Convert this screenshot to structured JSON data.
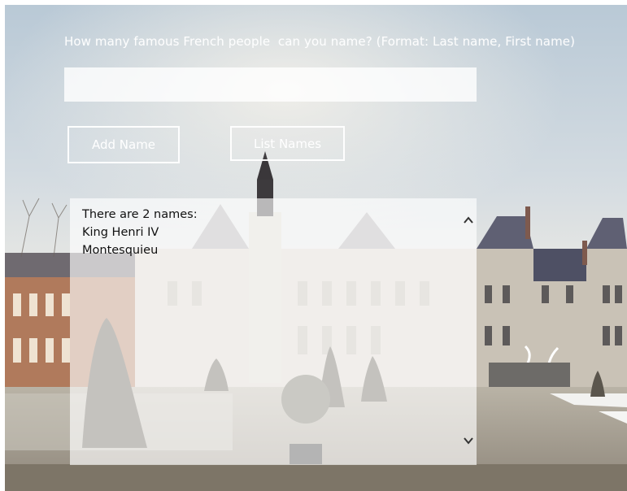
{
  "app": {
    "prompt": "How many famous French people  can you name? (Format: Last name, First name)"
  },
  "input": {
    "value": "",
    "placeholder": ""
  },
  "buttons": {
    "add_label": "Add Name",
    "list_label": "List Names"
  },
  "output": {
    "lines": [
      "There are 2 names:",
      "King Henri IV",
      "Montesquieu"
    ]
  },
  "icons": {
    "scroll_up": "chevron-up-icon",
    "scroll_down": "chevron-down-icon"
  },
  "colors": {
    "button_border": "#ffffff",
    "text_light": "#ffffff",
    "output_text": "#111111"
  }
}
